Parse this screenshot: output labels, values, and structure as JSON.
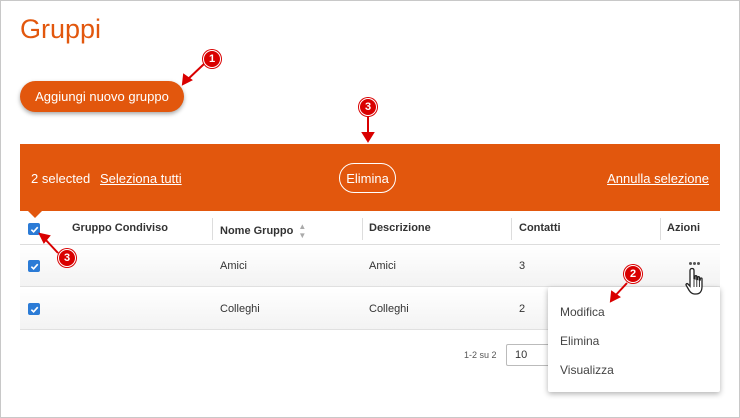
{
  "page": {
    "title": "Gruppi"
  },
  "actions": {
    "add_group_label": "Aggiungi nuovo gruppo"
  },
  "selection_bar": {
    "selected_text": "2 selected",
    "select_all_label": "Seleziona tutti",
    "delete_label": "Elimina",
    "cancel_label": "Annulla selezione"
  },
  "table": {
    "columns": [
      "Gruppo Condiviso",
      "Nome Gruppo",
      "Descrizione",
      "Contatti",
      "Azioni"
    ],
    "rows": [
      {
        "name": "Amici",
        "description": "Amici",
        "contacts": "3",
        "checked": true
      },
      {
        "name": "Colleghi",
        "description": "Colleghi",
        "contacts": "2",
        "checked": true
      }
    ]
  },
  "row_menu": {
    "items": [
      "Modifica",
      "Elimina",
      "Visualizza"
    ]
  },
  "pagination": {
    "range_text": "1-2 su 2",
    "page_size": "10"
  },
  "annotations": {
    "markers": [
      "1",
      "2",
      "3",
      "3"
    ]
  },
  "colors": {
    "accent": "#e2570d",
    "checkbox": "#2b7bd6",
    "marker": "#d90000"
  }
}
